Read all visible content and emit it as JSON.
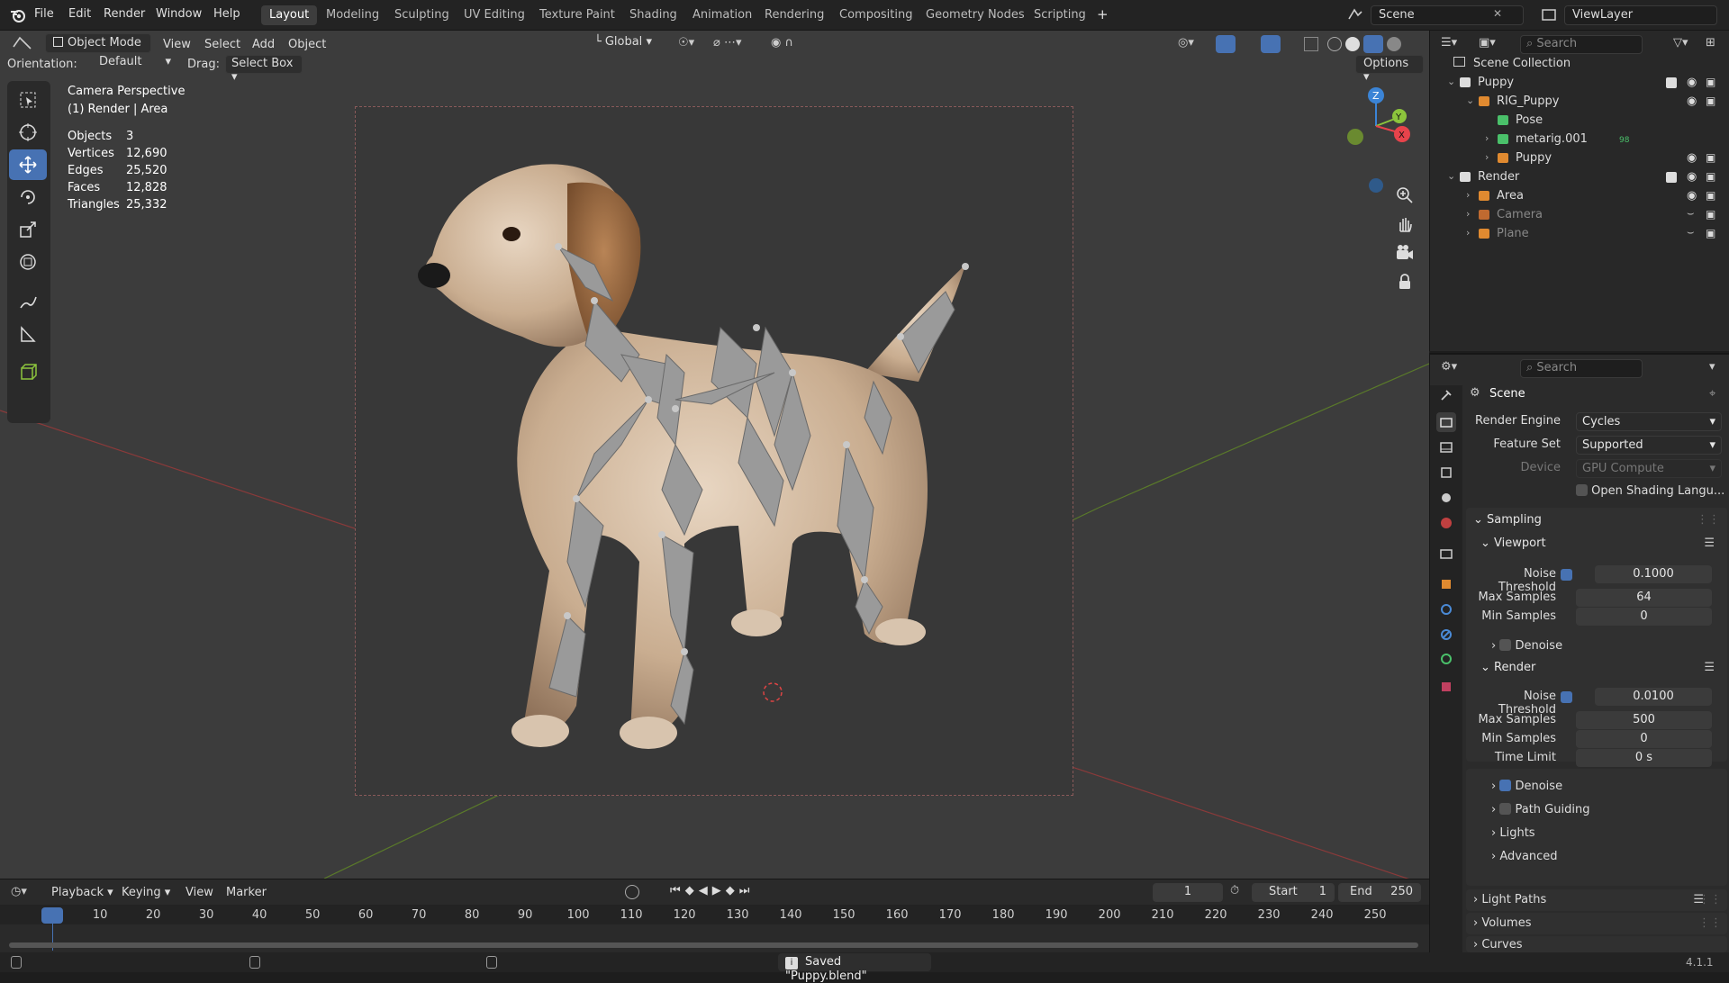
{
  "menubar": {
    "items": [
      "File",
      "Edit",
      "Render",
      "Window",
      "Help"
    ],
    "workspaces": [
      "Layout",
      "Modeling",
      "Sculpting",
      "UV Editing",
      "Texture Paint",
      "Shading",
      "Animation",
      "Rendering",
      "Compositing",
      "Geometry Nodes",
      "Scripting"
    ],
    "active_workspace": "Layout",
    "add_tab": "+",
    "scene_name": "Scene",
    "view_layer": "ViewLayer"
  },
  "viewport_header": {
    "mode": "Object Mode",
    "menus": [
      "View",
      "Select",
      "Add",
      "Object"
    ],
    "transform_orientation": "Global",
    "orientation_label": "Orientation:",
    "orientation_value": "Default",
    "drag_label": "Drag:",
    "drag_value": "Select Box",
    "options": "Options"
  },
  "viewport_overlay": {
    "view_name": "Camera Perspective",
    "collection_info": "(1) Render | Area",
    "stats": [
      {
        "label": "Objects",
        "value": "3"
      },
      {
        "label": "Vertices",
        "value": "12,690"
      },
      {
        "label": "Edges",
        "value": "25,520"
      },
      {
        "label": "Faces",
        "value": "12,828"
      },
      {
        "label": "Triangles",
        "value": "25,332"
      }
    ],
    "gizmo_axes": {
      "z": "Z",
      "y": "Y",
      "x": "X"
    }
  },
  "timeline": {
    "menus": [
      "Playback",
      "Keying",
      "View",
      "Marker"
    ],
    "current_frame": "1",
    "start_label": "Start",
    "start": "1",
    "end_label": "End",
    "end": "250",
    "ticks": [
      "1",
      "10",
      "20",
      "30",
      "40",
      "50",
      "60",
      "70",
      "80",
      "90",
      "100",
      "110",
      "120",
      "130",
      "140",
      "150",
      "160",
      "170",
      "180",
      "190",
      "200",
      "210",
      "220",
      "230",
      "240",
      "250"
    ]
  },
  "status": {
    "message": "Saved \"Puppy.blend\"",
    "version": "4.1.1"
  },
  "outliner": {
    "search_placeholder": "Search",
    "root": "Scene Collection",
    "rows": [
      {
        "label": "Puppy",
        "indent": 1,
        "icon": "collection-icon"
      },
      {
        "label": "RIG_Puppy",
        "indent": 2,
        "icon": "armature-icon"
      },
      {
        "label": "Pose",
        "indent": 3,
        "icon": "pose-icon"
      },
      {
        "label": "metarig.001",
        "indent": 3,
        "icon": "armature-data-icon"
      },
      {
        "label": "Puppy",
        "indent": 3,
        "icon": "mesh-icon"
      },
      {
        "label": "Render",
        "indent": 1,
        "icon": "collection-icon"
      },
      {
        "label": "Area",
        "indent": 2,
        "icon": "light-icon"
      },
      {
        "label": "Camera",
        "indent": 2,
        "icon": "camera-icon"
      },
      {
        "label": "Plane",
        "indent": 2,
        "icon": "mesh-icon"
      }
    ],
    "metarig_badge": "98"
  },
  "properties": {
    "search_placeholder": "Search",
    "context": "Scene",
    "render_engine_label": "Render Engine",
    "render_engine": "Cycles",
    "feature_set_label": "Feature Set",
    "feature_set": "Supported",
    "device_label": "Device",
    "device": "GPU Compute",
    "osl_label": "Open Shading Langu...",
    "sampling": "Sampling",
    "viewport": "Viewport",
    "vp_noise_label": "Noise Threshold",
    "vp_noise": "0.1000",
    "vp_max_label": "Max Samples",
    "vp_max": "64",
    "vp_min_label": "Min Samples",
    "vp_min": "0",
    "vp_denoise": "Denoise",
    "render": "Render",
    "r_noise_label": "Noise Threshold",
    "r_noise": "0.0100",
    "r_max_label": "Max Samples",
    "r_max": "500",
    "r_min_label": "Min Samples",
    "r_min": "0",
    "r_time_label": "Time Limit",
    "r_time": "0 s",
    "r_denoise": "Denoise",
    "path_guiding": "Path Guiding",
    "lights": "Lights",
    "advanced": "Advanced",
    "light_paths": "Light Paths",
    "volumes": "Volumes",
    "curves": "Curves"
  },
  "colors": {
    "accent": "#4772b3",
    "x_axis": "#e8434b",
    "y_axis": "#8cc43c",
    "z_axis": "#3b84d6"
  }
}
